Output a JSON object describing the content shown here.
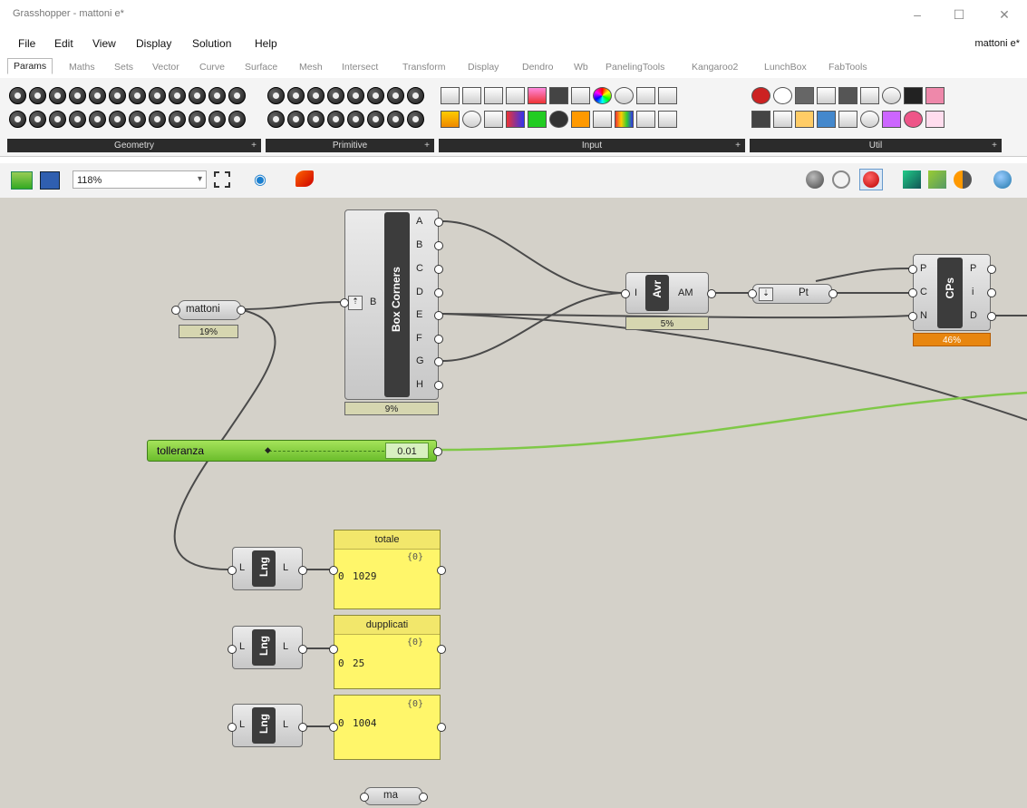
{
  "window": {
    "title": "Grasshopper - mattoni e*",
    "minimize": "–",
    "maximize": "☐",
    "close": "✕"
  },
  "menu": {
    "items": [
      "File",
      "Edit",
      "View",
      "Display",
      "Solution",
      "Help"
    ],
    "doc_name": "mattoni e*"
  },
  "tabs": [
    "Params",
    "Maths",
    "Sets",
    "Vector",
    "Curve",
    "Surface",
    "Mesh",
    "Intersect",
    "Transform",
    "Display",
    "Dendro",
    "Wb",
    "PanelingTools",
    "Kangaroo2",
    "LunchBox",
    "FabTools"
  ],
  "ribbon": {
    "groups": [
      {
        "label": "Geometry",
        "expand": "+"
      },
      {
        "label": "Primitive",
        "expand": "+"
      },
      {
        "label": "Input",
        "expand": "+"
      },
      {
        "label": "Util",
        "expand": "+"
      }
    ]
  },
  "toolbar": {
    "zoom": "118%"
  },
  "canvas": {
    "mattoni": {
      "label": "mattoni",
      "percent": "19%"
    },
    "box_corners": {
      "title": "Box Corners",
      "input": "B",
      "outputs": [
        "A",
        "B",
        "C",
        "D",
        "E",
        "F",
        "G",
        "H"
      ],
      "percent": "9%"
    },
    "avr": {
      "title": "Avr",
      "input": "I",
      "output": "AM",
      "percent": "5%"
    },
    "pt": {
      "label": "Pt"
    },
    "cps": {
      "title": "CPs",
      "inputs": [
        "P",
        "C",
        "N"
      ],
      "outputs": [
        "P",
        "i",
        "D"
      ],
      "percent": "46%"
    },
    "slider": {
      "label": "tolleranza",
      "value": "0.01"
    },
    "lng1": {
      "title": "Lng",
      "input": "L",
      "output": "L"
    },
    "lng2": {
      "title": "Lng",
      "input": "L",
      "output": "L"
    },
    "lng3": {
      "title": "Lng",
      "input": "L",
      "output": "L"
    },
    "panel1": {
      "title": "totale",
      "index": "{0}",
      "row_index": "0",
      "value": "1029"
    },
    "panel2": {
      "title": "dupplicati",
      "index": "{0}",
      "row_index": "0",
      "value": "25"
    },
    "panel3": {
      "index": "{0}",
      "row_index": "0",
      "value": "1004"
    },
    "ma": {
      "label": "ma"
    }
  }
}
